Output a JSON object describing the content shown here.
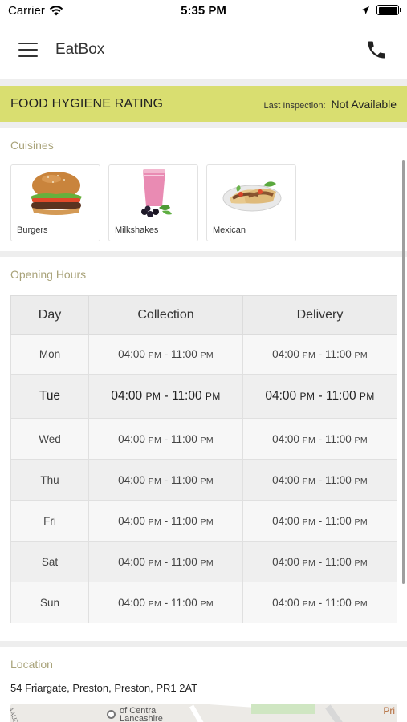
{
  "status_bar": {
    "carrier": "Carrier",
    "time": "5:35 PM"
  },
  "header": {
    "title": "EatBox"
  },
  "hygiene": {
    "title": "FOOD HYGIENE RATING",
    "inspection_label": "Last Inspection:",
    "inspection_value": "Not Available",
    "bar_color": "#d9de70"
  },
  "cuisines": {
    "label": "Cuisines",
    "items": [
      {
        "name": "Burgers",
        "icon": "burger-icon"
      },
      {
        "name": "Milkshakes",
        "icon": "milkshake-icon"
      },
      {
        "name": "Mexican",
        "icon": "taco-icon"
      }
    ]
  },
  "opening_hours": {
    "label": "Opening Hours",
    "headers": [
      "Day",
      "Collection",
      "Delivery"
    ],
    "rows": [
      {
        "day": "Mon",
        "collection": {
          "open": "04:00",
          "open_ampm": "PM",
          "sep": " - ",
          "close": "11:00",
          "close_ampm": "PM"
        },
        "delivery": {
          "open": "04:00",
          "open_ampm": "PM",
          "sep": " - ",
          "close": "11:00",
          "close_ampm": "PM"
        }
      },
      {
        "day": "Tue",
        "collection": {
          "open": "04:00",
          "open_ampm": "PM",
          "sep": " - ",
          "close": "11:00",
          "close_ampm": "PM"
        },
        "delivery": {
          "open": "04:00",
          "open_ampm": "PM",
          "sep": " - ",
          "close": "11:00",
          "close_ampm": "PM"
        }
      },
      {
        "day": "Wed",
        "collection": {
          "open": "04:00",
          "open_ampm": "PM",
          "sep": " - ",
          "close": "11:00",
          "close_ampm": "PM"
        },
        "delivery": {
          "open": "04:00",
          "open_ampm": "PM",
          "sep": " - ",
          "close": "11:00",
          "close_ampm": "PM"
        }
      },
      {
        "day": "Thu",
        "collection": {
          "open": "04:00",
          "open_ampm": "PM",
          "sep": " - ",
          "close": "11:00",
          "close_ampm": "PM"
        },
        "delivery": {
          "open": "04:00",
          "open_ampm": "PM",
          "sep": " - ",
          "close": "11:00",
          "close_ampm": "PM"
        }
      },
      {
        "day": "Fri",
        "collection": {
          "open": "04:00",
          "open_ampm": "PM",
          "sep": " - ",
          "close": "11:00",
          "close_ampm": "PM"
        },
        "delivery": {
          "open": "04:00",
          "open_ampm": "PM",
          "sep": " - ",
          "close": "11:00",
          "close_ampm": "PM"
        }
      },
      {
        "day": "Sat",
        "collection": {
          "open": "04:00",
          "open_ampm": "PM",
          "sep": " - ",
          "close": "11:00",
          "close_ampm": "PM"
        },
        "delivery": {
          "open": "04:00",
          "open_ampm": "PM",
          "sep": " - ",
          "close": "11:00",
          "close_ampm": "PM"
        }
      },
      {
        "day": "Sun",
        "collection": {
          "open": "04:00",
          "open_ampm": "PM",
          "sep": " - ",
          "close": "11:00",
          "close_ampm": "PM"
        },
        "delivery": {
          "open": "04:00",
          "open_ampm": "PM",
          "sep": " - ",
          "close": "11:00",
          "close_ampm": "PM"
        }
      }
    ]
  },
  "location": {
    "label": "Location",
    "address": "54 Friargate, Preston, Preston, PR1 2AT",
    "map": {
      "poi_line1": "of Central",
      "poi_line2": "Lancashire",
      "side_label": "AAUD",
      "corner_label": "Pri"
    }
  }
}
